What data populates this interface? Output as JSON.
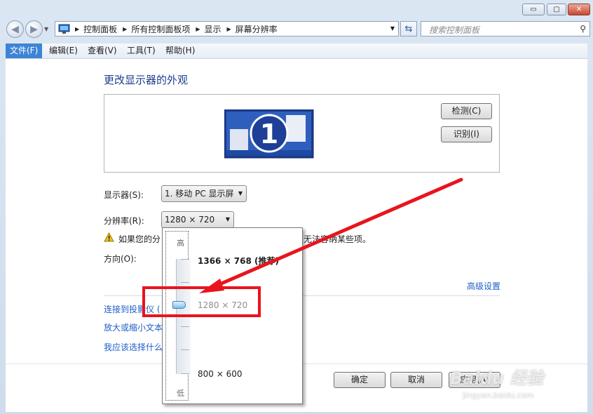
{
  "titlebar": {
    "minimize": "▭",
    "maximize": "▢",
    "close": "✕"
  },
  "address_bar": {
    "breadcrumbs": [
      "控制面板",
      "所有控制面板项",
      "显示",
      "屏幕分辨率"
    ]
  },
  "search": {
    "placeholder": "搜索控制面板"
  },
  "menubar": [
    "文件(F)",
    "编辑(E)",
    "查看(V)",
    "工具(T)",
    "帮助(H)"
  ],
  "main": {
    "heading": "更改显示器的外观",
    "monitor_number": "1",
    "detect_button": "检测(C)",
    "identify_button": "识别(I)",
    "display_label": "显示器(S):",
    "display_value": "1. 移动 PC 显示屏",
    "resolution_label": "分辨率(R):",
    "resolution_value": "1280 × 720",
    "warning_prefix": "如果您的分",
    "warning_suffix": "无法容纳某些项。",
    "orientation_label": "方向(O):",
    "advanced_link": "高级设置",
    "link_projector": "连接到投影仪 (",
    "link_text_size": "放大或缩小文本",
    "link_choose": "我应该选择什么"
  },
  "resolution_popup": {
    "high": "高",
    "low": "低",
    "options": [
      "1366 × 768 (推荐)",
      "1280 × 720",
      "800 × 600"
    ],
    "selected": "1280 × 720"
  },
  "footer": {
    "ok": "确定",
    "cancel": "取消",
    "apply": "应用(A)"
  },
  "watermark": {
    "brand": "Baidu 经验",
    "url": "jingyan.baidu.com"
  },
  "colors": {
    "accent": "#3d84d6",
    "link": "#1d5ec8",
    "heading": "#1d3c8f",
    "annotation": "#e8141d"
  }
}
